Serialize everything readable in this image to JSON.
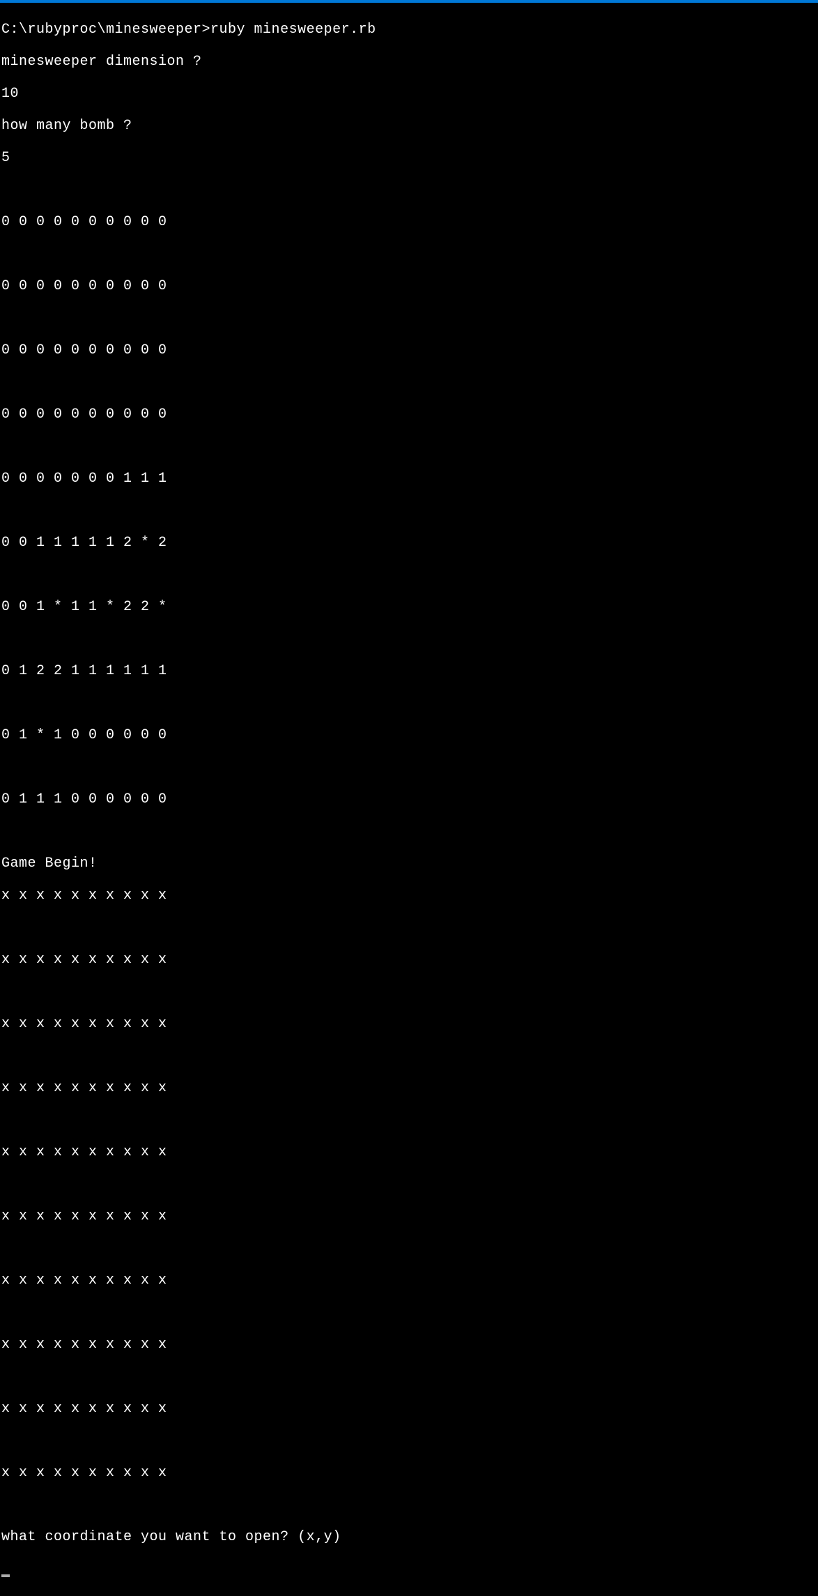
{
  "prompt_line": "C:\\rubyproc\\minesweeper>ruby minesweeper.rb",
  "dim_prompt": "minesweeper dimension ?",
  "dim_value": "10",
  "bomb_prompt": "how many bomb ?",
  "bomb_value": "5",
  "grid_revealed": [
    "0 0 0 0 0 0 0 0 0 0",
    "0 0 0 0 0 0 0 0 0 0",
    "0 0 0 0 0 0 0 0 0 0",
    "0 0 0 0 0 0 0 0 0 0",
    "0 0 0 0 0 0 0 1 1 1",
    "0 0 1 1 1 1 1 2 * 2",
    "0 0 1 * 1 1 * 2 2 *",
    "0 1 2 2 1 1 1 1 1 1",
    "0 1 * 1 0 0 0 0 0 0",
    "0 1 1 1 0 0 0 0 0 0"
  ],
  "game_begin": "Game Begin!",
  "grid_hidden": [
    "x x x x x x x x x x",
    "x x x x x x x x x x",
    "x x x x x x x x x x",
    "x x x x x x x x x x",
    "x x x x x x x x x x",
    "x x x x x x x x x x",
    "x x x x x x x x x x",
    "x x x x x x x x x x",
    "x x x x x x x x x x",
    "x x x x x x x x x x"
  ],
  "coord_prompt": "what coordinate you want to open? (x,y)"
}
